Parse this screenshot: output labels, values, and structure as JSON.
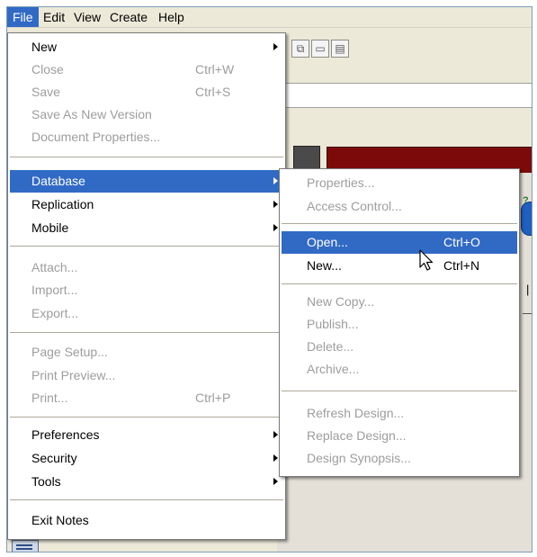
{
  "menubar": {
    "items": [
      {
        "label": "File"
      },
      {
        "label": "Edit"
      },
      {
        "label": "View"
      },
      {
        "label": "Create"
      },
      {
        "label": "Help"
      }
    ]
  },
  "file_menu": {
    "new": {
      "label": "New"
    },
    "close": {
      "label": "Close",
      "shortcut": "Ctrl+W"
    },
    "save": {
      "label": "Save",
      "shortcut": "Ctrl+S"
    },
    "save_as_new_version": {
      "label": "Save As New Version"
    },
    "document_properties": {
      "label": "Document Properties..."
    },
    "database": {
      "label": "Database"
    },
    "replication": {
      "label": "Replication"
    },
    "mobile": {
      "label": "Mobile"
    },
    "attach": {
      "label": "Attach..."
    },
    "import": {
      "label": "Import..."
    },
    "export": {
      "label": "Export..."
    },
    "page_setup": {
      "label": "Page Setup..."
    },
    "print_preview": {
      "label": "Print Preview..."
    },
    "print": {
      "label": "Print...",
      "shortcut": "Ctrl+P"
    },
    "preferences": {
      "label": "Preferences"
    },
    "security": {
      "label": "Security"
    },
    "tools": {
      "label": "Tools"
    },
    "exit_notes": {
      "label": "Exit Notes"
    }
  },
  "database_menu": {
    "properties": {
      "label": "Properties..."
    },
    "access_control": {
      "label": "Access Control..."
    },
    "open": {
      "label": "Open...",
      "shortcut": "Ctrl+O"
    },
    "new": {
      "label": "New...",
      "shortcut": "Ctrl+N"
    },
    "new_copy": {
      "label": "New Copy..."
    },
    "publish": {
      "label": "Publish..."
    },
    "delete": {
      "label": "Delete..."
    },
    "archive": {
      "label": "Archive..."
    },
    "refresh_design": {
      "label": "Refresh Design..."
    },
    "replace_design": {
      "label": "Replace Design..."
    },
    "design_synopsis": {
      "label": "Design Synopsis..."
    }
  },
  "background": {
    "toolbar_icons": [
      "copy-icon",
      "paste-icon",
      "document-icon"
    ],
    "colors": {
      "highlight": "#316ac5",
      "banner": "#7d0a0a",
      "disabled_text": "#9d9d9d"
    }
  }
}
